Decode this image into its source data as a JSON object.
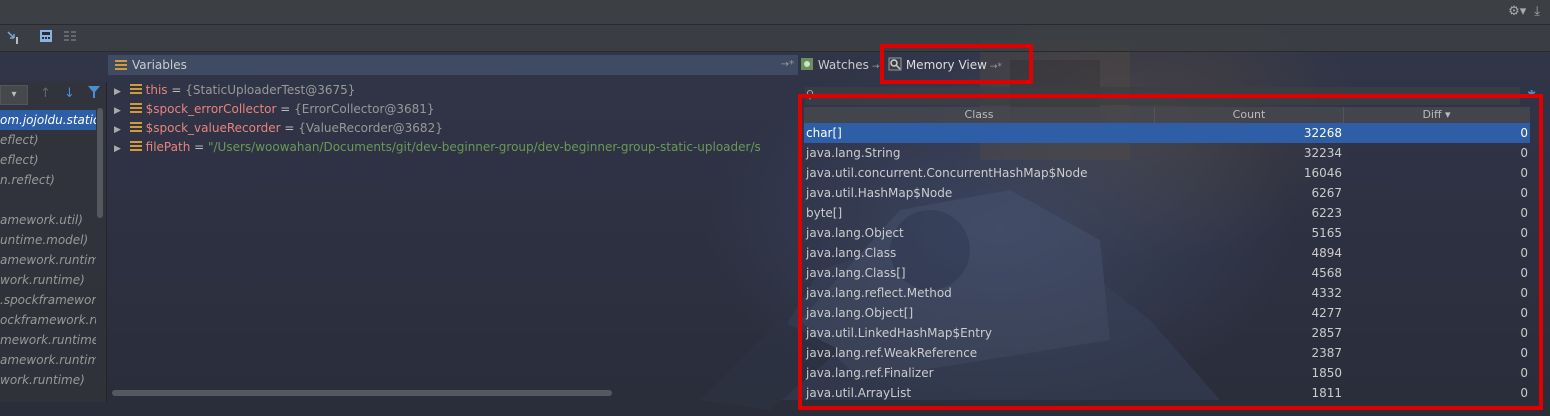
{
  "variables_panel": {
    "title": "Variables",
    "pin": "→*",
    "items": [
      {
        "arrow": "▶",
        "name": "this",
        "eq": " = ",
        "value": "{StaticUploaderTest@3675}",
        "kind": "ref"
      },
      {
        "arrow": "▶",
        "name": "$spock_errorCollector",
        "eq": " = ",
        "value": "{ErrorCollector@3681}",
        "kind": "ref"
      },
      {
        "arrow": "▶",
        "name": "$spock_valueRecorder",
        "eq": " = ",
        "value": "{ValueRecorder@3682}",
        "kind": "ref"
      },
      {
        "arrow": "▶",
        "name": "filePath",
        "eq": " = ",
        "value": "\"/Users/woowahan/Documents/git/dev-beginner-group/dev-beginner-group-static-uploader/s",
        "kind": "string"
      }
    ]
  },
  "frames_panel": {
    "dropdown": "▾",
    "items": [
      {
        "text": "om.jojoldu.static",
        "selected": true
      },
      {
        "text": "eflect)",
        "selected": false
      },
      {
        "text": "eflect)",
        "selected": false
      },
      {
        "text": "n.reflect)",
        "selected": false
      },
      {
        "text": "",
        "selected": false
      },
      {
        "text": "amework.util)",
        "selected": false
      },
      {
        "text": "untime.model)",
        "selected": false
      },
      {
        "text": "amework.runtim",
        "selected": false
      },
      {
        "text": "work.runtime)",
        "selected": false
      },
      {
        "text": ".spockframewor",
        "selected": false
      },
      {
        "text": "ockframework.ru",
        "selected": false
      },
      {
        "text": "mework.runtime",
        "selected": false
      },
      {
        "text": "amework.runtim",
        "selected": false
      },
      {
        "text": "work.runtime)",
        "selected": false
      }
    ]
  },
  "tabs": {
    "watches": "Watches",
    "watches_pin": "→*",
    "memory_view": "Memory View",
    "memory_pin": "→*"
  },
  "memory_table": {
    "columns": {
      "class": "Class",
      "count": "Count",
      "diff": "Diff ▾"
    },
    "rows": [
      {
        "class": "char[]",
        "count": "32268",
        "diff": "0",
        "selected": true
      },
      {
        "class": "java.lang.String",
        "count": "32234",
        "diff": "0"
      },
      {
        "class": "java.util.concurrent.ConcurrentHashMap$Node",
        "count": "16046",
        "diff": "0"
      },
      {
        "class": "java.util.HashMap$Node",
        "count": "6267",
        "diff": "0"
      },
      {
        "class": "byte[]",
        "count": "6223",
        "diff": "0"
      },
      {
        "class": "java.lang.Object",
        "count": "5165",
        "diff": "0"
      },
      {
        "class": "java.lang.Class",
        "count": "4894",
        "diff": "0"
      },
      {
        "class": "java.lang.Class[]",
        "count": "4568",
        "diff": "0"
      },
      {
        "class": "java.lang.reflect.Method",
        "count": "4332",
        "diff": "0"
      },
      {
        "class": "java.lang.Object[]",
        "count": "4277",
        "diff": "0"
      },
      {
        "class": "java.util.LinkedHashMap$Entry",
        "count": "2857",
        "diff": "0"
      },
      {
        "class": "java.lang.ref.WeakReference",
        "count": "2387",
        "diff": "0"
      },
      {
        "class": "java.lang.ref.Finalizer",
        "count": "1850",
        "diff": "0"
      },
      {
        "class": "java.util.ArrayList",
        "count": "1811",
        "diff": "0"
      }
    ]
  },
  "icons": {
    "settings": "⚙▾",
    "download": "⤓",
    "search": "⚲",
    "table_settings": "✱"
  },
  "colors": {
    "highlight_red": "#e00000",
    "selection_blue": "#2d5ea6",
    "variable_name": "#e8847d",
    "string_value": "#6a9955"
  }
}
